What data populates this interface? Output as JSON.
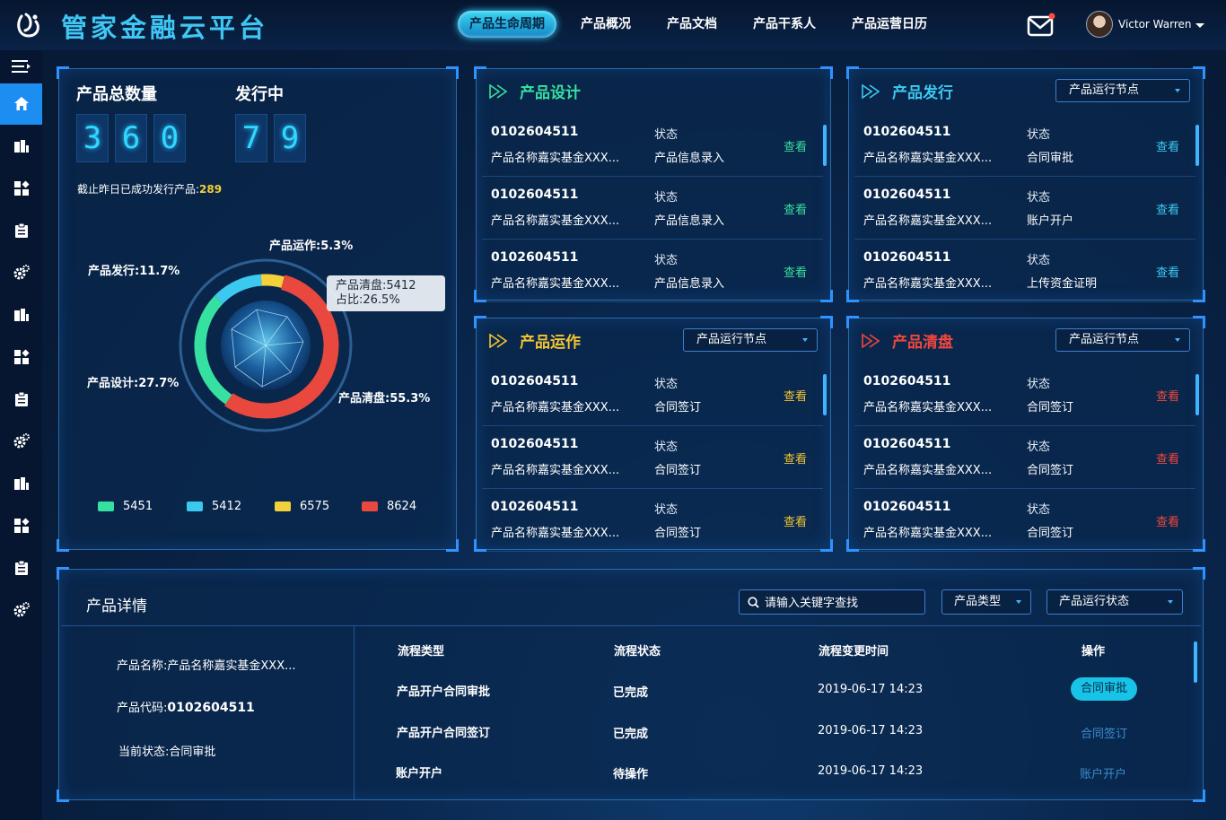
{
  "app": {
    "title": "管家金融云平台"
  },
  "nav": [
    {
      "label": "产品生命周期",
      "active": true
    },
    {
      "label": "产品概况"
    },
    {
      "label": "产品文档"
    },
    {
      "label": "产品干系人"
    },
    {
      "label": "产品运营日历"
    }
  ],
  "user": {
    "name": "Victor Warren"
  },
  "summary": {
    "total_label": "产品总数量",
    "total_digits": [
      "3",
      "6",
      "0"
    ],
    "issuing_label": "发行中",
    "issuing_digits": [
      "7",
      "9"
    ],
    "issued_note": "截止昨日已成功发行产品:",
    "issued_count": "289"
  },
  "chart_data": {
    "type": "pie",
    "categories": [
      "产品设计",
      "产品发行",
      "产品运作",
      "产品清盘"
    ],
    "values": [
      27.7,
      11.7,
      5.3,
      55.3
    ],
    "labels": [
      "产品设计:27.7%",
      "产品发行:11.7%",
      "产品运作:5.3%",
      "产品清盘:55.3%"
    ],
    "legend_values": [
      "5451",
      "5412",
      "6575",
      "8624"
    ],
    "colors": [
      "#36e0a0",
      "#3cc9f0",
      "#f3d13a",
      "#e8483d"
    ],
    "tooltip": {
      "line1": "产品清盘:5412",
      "line2": "占比:26.5%"
    }
  },
  "panels": [
    {
      "title": "产品设计",
      "color": "#36e0a0",
      "has_select": false,
      "rows": [
        {
          "code": "0102604511",
          "name": "产品名称嘉实基金XXX...",
          "status_label": "状态",
          "status": "产品信息录入",
          "action": "查看"
        },
        {
          "code": "0102604511",
          "name": "产品名称嘉实基金XXX...",
          "status_label": "状态",
          "status": "产品信息录入",
          "action": "查看"
        },
        {
          "code": "0102604511",
          "name": "产品名称嘉实基金XXX...",
          "status_label": "状态",
          "status": "产品信息录入",
          "action": "查看"
        }
      ]
    },
    {
      "title": "产品发行",
      "color": "#3cc9f0",
      "has_select": true,
      "select": "产品运行节点",
      "rows": [
        {
          "code": "0102604511",
          "name": "产品名称嘉实基金XXX...",
          "status_label": "状态",
          "status": "合同审批",
          "action": "查看"
        },
        {
          "code": "0102604511",
          "name": "产品名称嘉实基金XXX...",
          "status_label": "状态",
          "status": "账户开户",
          "action": "查看"
        },
        {
          "code": "0102604511",
          "name": "产品名称嘉实基金XXX...",
          "status_label": "状态",
          "status": "上传资金证明",
          "action": "查看"
        }
      ]
    },
    {
      "title": "产品运作",
      "color": "#f3c531",
      "has_select": true,
      "select": "产品运行节点",
      "rows": [
        {
          "code": "0102604511",
          "name": "产品名称嘉实基金XXX...",
          "status_label": "状态",
          "status": "合同签订",
          "action": "查看"
        },
        {
          "code": "0102604511",
          "name": "产品名称嘉实基金XXX...",
          "status_label": "状态",
          "status": "合同签订",
          "action": "查看"
        },
        {
          "code": "0102604511",
          "name": "产品名称嘉实基金XXX...",
          "status_label": "状态",
          "status": "合同签订",
          "action": "查看"
        }
      ]
    },
    {
      "title": "产品清盘",
      "color": "#f0473c",
      "has_select": true,
      "select": "产品运行节点",
      "rows": [
        {
          "code": "0102604511",
          "name": "产品名称嘉实基金XXX...",
          "status_label": "状态",
          "status": "合同签订",
          "action": "查看"
        },
        {
          "code": "0102604511",
          "name": "产品名称嘉实基金XXX...",
          "status_label": "状态",
          "status": "合同签订",
          "action": "查看"
        },
        {
          "code": "0102604511",
          "name": "产品名称嘉实基金XXX...",
          "status_label": "状态",
          "status": "合同签订",
          "action": "查看"
        }
      ]
    }
  ],
  "detail": {
    "title": "产品详情",
    "search_placeholder": "请输入关键字查找",
    "type_select": "产品类型",
    "status_select": "产品运行状态",
    "name_label": "产品名称:",
    "name_value": "产品名称嘉实基金XXX...",
    "code_label": "产品代码:",
    "code_value": "0102604511",
    "state_label": "当前状态:",
    "state_value": "合同审批",
    "columns": [
      "流程类型",
      "流程状态",
      "流程变更时间",
      "操作"
    ],
    "rows": [
      {
        "type": "产品开户合同审批",
        "state": "已完成",
        "time": "2019-06-17  14:23",
        "op": "合同审批",
        "op_active": true
      },
      {
        "type": "产品开户合同签订",
        "state": "已完成",
        "time": "2019-06-17  14:23",
        "op": "合同签订",
        "op_active": false
      },
      {
        "type": "账户开户",
        "state": "待操作",
        "time": "2019-06-17  14:23",
        "op": "账户开户",
        "op_active": false
      }
    ]
  }
}
